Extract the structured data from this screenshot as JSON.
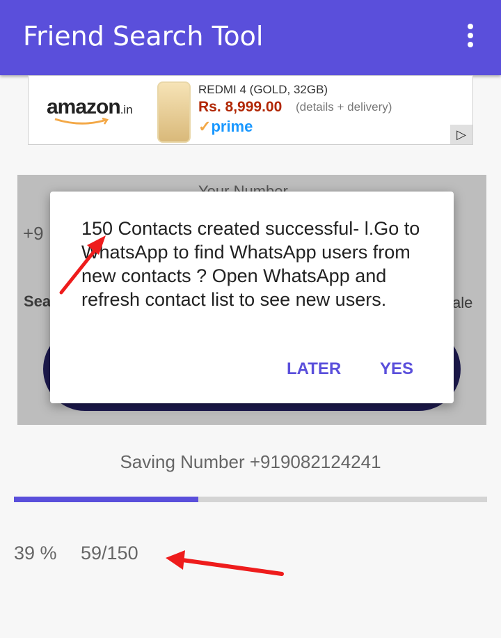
{
  "app": {
    "title": "Friend Search Tool",
    "menu_icon": "more-vert-icon",
    "accent": "#5a4fdb"
  },
  "ad": {
    "brand": "amazon",
    "brand_suffix": ".in",
    "product": "REDMI 4 (GOLD, 32GB)",
    "price": "Rs. 8,999.00",
    "details": "(details + delivery)",
    "prime_check": "✓",
    "prime": "prime",
    "adchoice": "▷"
  },
  "background": {
    "your_number_label": "Your Number",
    "number_prefix": "+9",
    "search_fragment": "Sea",
    "gender_fragment": "ale"
  },
  "dialog": {
    "message": "150 Contacts created successful- l.Go to WhatsApp to find WhatsApp users from new contacts ? Open WhatsApp and refresh contact list to see new users.",
    "later": "LATER",
    "yes": "YES"
  },
  "status": {
    "saving_text": "Saving Number +919082124241",
    "progress_fraction": 0.39,
    "percent_text": "39 %",
    "count_text": "59/150"
  }
}
